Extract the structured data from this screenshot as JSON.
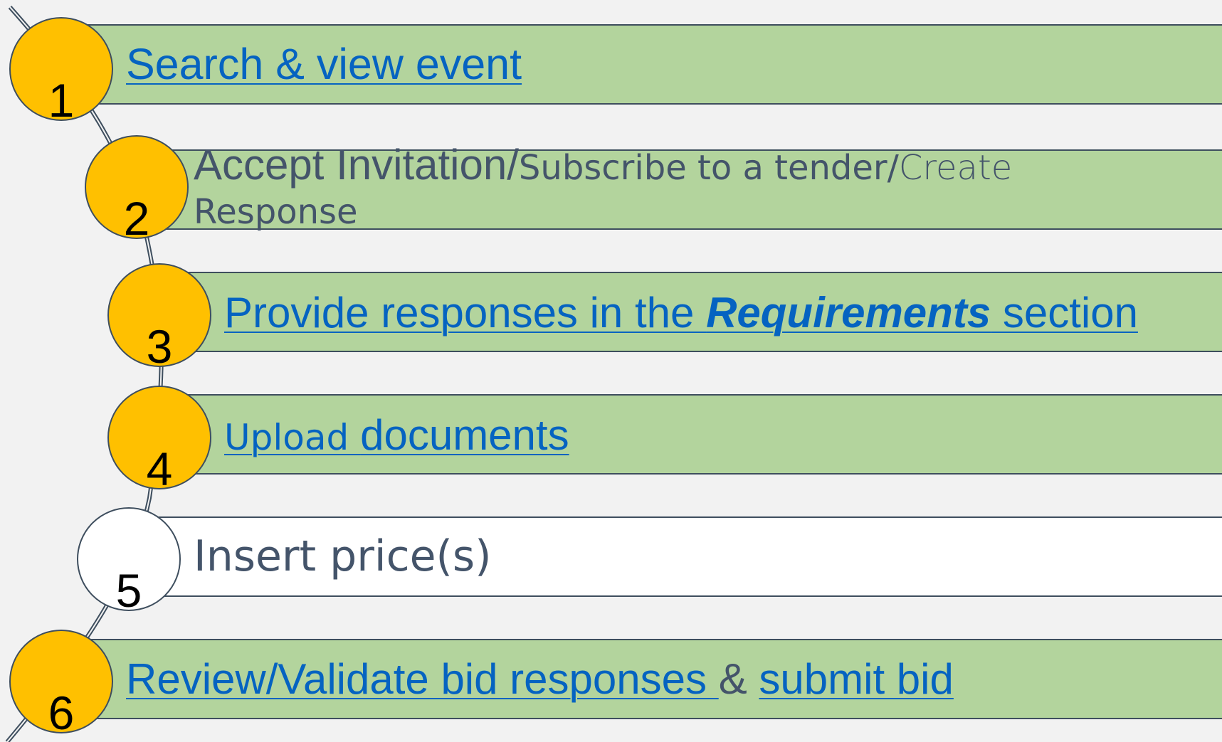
{
  "steps": [
    {
      "num": "1",
      "text": "Search & view event",
      "fill": "#b3d49d"
    },
    {
      "num": "2",
      "text_a": "Accept Invitation/",
      "text_b": "Subscribe to a tender/",
      "text_c": "Create",
      "text_d": "Response",
      "fill": "#b3d49d"
    },
    {
      "num": "3",
      "text_a": "Provide responses in the ",
      "text_b": "Requirements",
      "text_c": " section",
      "fill": "#b3d49d"
    },
    {
      "num": "4",
      "text_a": "Upload ",
      "text_b": "documents",
      "fill": "#b3d49d"
    },
    {
      "num": "5",
      "text": "Insert price(s)",
      "fill": "#ffffff"
    },
    {
      "num": "6",
      "text_a": "Review/Validate bid responses ",
      "text_b": "& ",
      "text_c": "submit bid",
      "fill": "#b3d49d"
    }
  ],
  "colors": {
    "circle_fill": "#ffc000",
    "link": "#0563c1",
    "outline": "#3e4e5e",
    "background": "#f2f2f2"
  }
}
